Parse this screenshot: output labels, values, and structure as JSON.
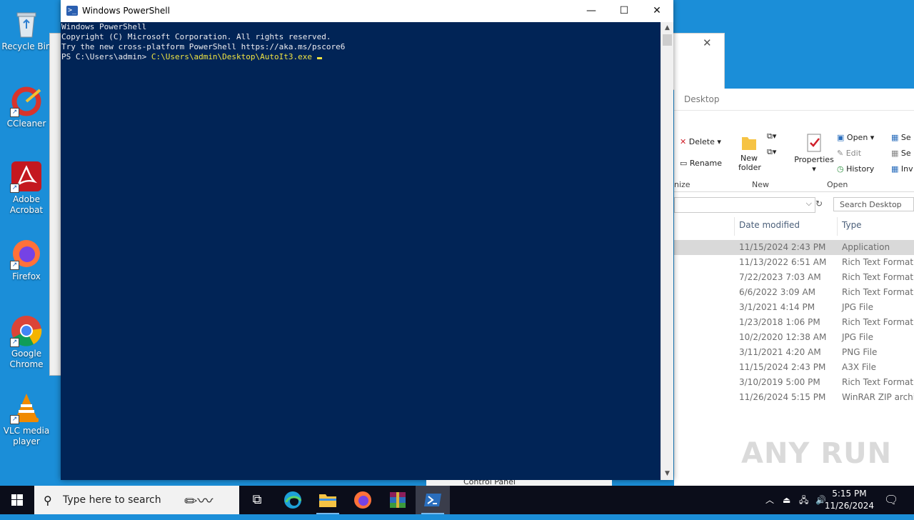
{
  "desktop": {
    "icons": [
      {
        "label": "Recycle Bin"
      },
      {
        "label": "CCleaner"
      },
      {
        "label": "Adobe Acrobat"
      },
      {
        "label": "Firefox"
      },
      {
        "label": "Google Chrome"
      },
      {
        "label": "VLC media player"
      }
    ]
  },
  "powershell": {
    "title": "Windows PowerShell",
    "lines": [
      "Windows PowerShell",
      "Copyright (C) Microsoft Corporation. All rights reserved.",
      "",
      "Try the new cross-platform PowerShell https://aka.ms/pscore6",
      ""
    ],
    "prompt": "PS C:\\Users\\admin> ",
    "command": "C:\\Users\\admin\\Desktop\\AutoIt3.exe",
    "minimize": "—",
    "maximize": "☐",
    "close": "✕"
  },
  "explorer": {
    "title": "Desktop",
    "ribbon": {
      "delete": "Delete",
      "rename": "Rename",
      "new_folder": "New folder",
      "properties": "Properties",
      "open": "Open",
      "edit": "Edit",
      "history": "History",
      "group_organize": "nize",
      "group_new": "New",
      "group_open": "Open",
      "select_1": "Se",
      "select_2": "Se",
      "select_3": "Inv"
    },
    "search_placeholder": "Search Desktop",
    "columns": {
      "date": "Date modified",
      "type": "Type"
    },
    "rows": [
      {
        "date": "11/15/2024 2:43 PM",
        "type": "Application",
        "selected": true
      },
      {
        "date": "11/13/2022 6:51 AM",
        "type": "Rich Text Format"
      },
      {
        "date": "7/22/2023 7:03 AM",
        "type": "Rich Text Format"
      },
      {
        "date": "6/6/2022 3:09 AM",
        "type": "Rich Text Format"
      },
      {
        "date": "3/1/2021 4:14 PM",
        "type": "JPG File"
      },
      {
        "date": "1/23/2018 1:06 PM",
        "type": "Rich Text Format"
      },
      {
        "date": "10/2/2020 12:38 AM",
        "type": "JPG File"
      },
      {
        "date": "3/11/2021 4:20 AM",
        "type": "PNG File"
      },
      {
        "date": "11/15/2024 2:43 PM",
        "type": "A3X File"
      },
      {
        "date": "3/10/2019 5:00 PM",
        "type": "Rich Text Format"
      },
      {
        "date": "11/26/2024 5:15 PM",
        "type": "WinRAR ZIP archive"
      }
    ]
  },
  "taskbar": {
    "search_placeholder": "Type here to search",
    "time": "5:15 PM",
    "date": "11/26/2024",
    "behind_window": "Control Panel"
  },
  "watermark": "ANY RUN",
  "colors": {
    "desktop": "#1b8ed8",
    "powershell_bg": "#012456",
    "command": "#f0e442"
  }
}
